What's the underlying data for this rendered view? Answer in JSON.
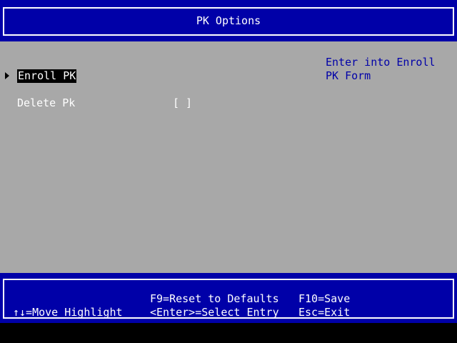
{
  "header": {
    "title": "PK Options"
  },
  "menu": {
    "items": [
      {
        "label": "Enroll PK",
        "selected": true
      },
      {
        "label": "Delete Pk",
        "value": "[ ]"
      }
    ]
  },
  "help": {
    "text": "Enter into Enroll PK Form"
  },
  "footer": {
    "move": "↑↓=Move Highlight",
    "reset": "F9=Reset to Defaults",
    "select": "<Enter>=Select Entry",
    "save": "F10=Save",
    "exit": "Esc=Exit"
  },
  "colors": {
    "bar": "#0000a8",
    "content": "#a8a8a8",
    "highlight": "#000000",
    "text": "#ffffff",
    "help_text": "#0000a8"
  },
  "icons": {
    "pointer": "right-triangle-pointer-icon"
  }
}
